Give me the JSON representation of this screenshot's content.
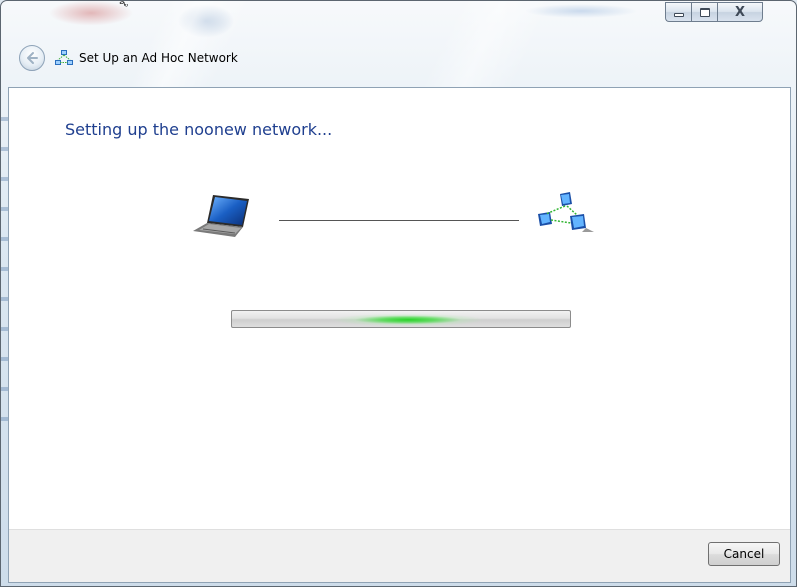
{
  "window": {
    "title": "Set Up an Ad Hoc Network",
    "top_fragment": "ຊ          ູ"
  },
  "icons": {
    "back": "back-arrow-icon",
    "title": "ad-hoc-network-icon",
    "computer": "laptop-icon",
    "network": "network-icon",
    "minimize": "minimize-icon",
    "maximize": "maximize-icon",
    "close": "close-icon"
  },
  "caption": {
    "close_glyph": "X"
  },
  "main": {
    "heading": "Setting up the noonew network..."
  },
  "progress": {
    "style": "marquee-indeterminate",
    "glow_position": 0.52
  },
  "footer": {
    "cancel_label": "Cancel"
  },
  "colors": {
    "heading": "#1f3f8f",
    "progress_glow": "#27d327",
    "footer_bg": "#f0f0f0"
  }
}
